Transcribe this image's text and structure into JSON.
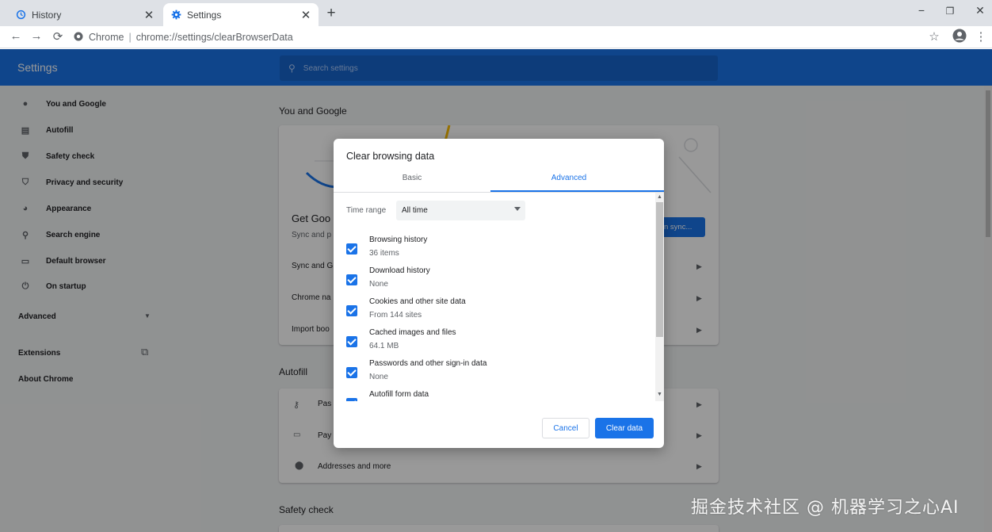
{
  "tabs": [
    {
      "title": "History",
      "icon": "history-icon",
      "active": false
    },
    {
      "title": "Settings",
      "icon": "gear-icon",
      "active": true
    }
  ],
  "window_controls": {
    "minimize": "−",
    "maximize": "❐",
    "close": "✕"
  },
  "toolbar": {
    "site_label": "Chrome",
    "url": "chrome://settings/clearBrowserData"
  },
  "settings": {
    "header_title": "Settings",
    "search_placeholder": "Search settings",
    "sidebar": [
      {
        "label": "You and Google",
        "icon": "person-icon"
      },
      {
        "label": "Autofill",
        "icon": "clipboard-icon"
      },
      {
        "label": "Safety check",
        "icon": "shield-check-icon"
      },
      {
        "label": "Privacy and security",
        "icon": "shield-icon"
      },
      {
        "label": "Appearance",
        "icon": "palette-icon"
      },
      {
        "label": "Search engine",
        "icon": "search-icon"
      },
      {
        "label": "Default browser",
        "icon": "browser-icon"
      },
      {
        "label": "On startup",
        "icon": "power-icon"
      }
    ],
    "advanced_label": "Advanced",
    "extensions_label": "Extensions",
    "about_label": "About Chrome",
    "sections": {
      "you_and_google": "You and Google",
      "get_google_truncated": "Get Goo",
      "sync_sub_truncated": "Sync and p",
      "sync_button_truncated": "n sync...",
      "row_sync_truncated": "Sync and G",
      "row_chrome_name_truncated": "Chrome na",
      "row_import_truncated": "Import boo",
      "autofill": "Autofill",
      "row_passwords_truncated": "Pas",
      "row_payment_truncated": "Pay",
      "row_addresses": "Addresses and more",
      "safety_check": "Safety check"
    }
  },
  "dialog": {
    "title": "Clear browsing data",
    "tabs": [
      {
        "label": "Basic",
        "selected": false
      },
      {
        "label": "Advanced",
        "selected": true
      }
    ],
    "time_range_label": "Time range",
    "time_range_value": "All time",
    "items": [
      {
        "title": "Browsing history",
        "subtitle": "36 items",
        "checked": true
      },
      {
        "title": "Download history",
        "subtitle": "None",
        "checked": true
      },
      {
        "title": "Cookies and other site data",
        "subtitle": "From 144 sites",
        "checked": true
      },
      {
        "title": "Cached images and files",
        "subtitle": "64.1 MB",
        "checked": true
      },
      {
        "title": "Passwords and other sign-in data",
        "subtitle": "None",
        "checked": true
      },
      {
        "title": "Autofill form data",
        "subtitle": "",
        "checked": true
      }
    ],
    "cancel_label": "Cancel",
    "clear_label": "Clear data"
  },
  "watermark": "掘金技术社区 @ 机器学习之心AI",
  "colors": {
    "accent": "#1a73e8",
    "header": "#1a73e8",
    "page_bg": "#f1f3f4"
  }
}
